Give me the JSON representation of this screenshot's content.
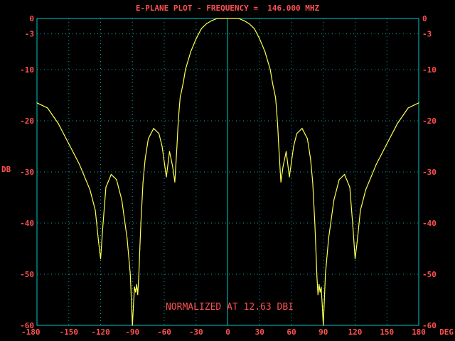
{
  "title": "E-PLANE PLOT - FREQUENCY =  146.000 MHZ",
  "annotation": "NORMALIZED AT 12.63 DBI",
  "colors": {
    "background": "#000000",
    "frame": "#00c8c8",
    "grid": "#00a8a8",
    "text": "#ff5050",
    "trace": "#ffff50"
  },
  "chart_data": {
    "type": "line",
    "title": "E-PLANE PLOT - FREQUENCY =  146.000 MHZ",
    "xlabel": "DEG",
    "ylabel": "DB",
    "xlim": [
      -180,
      180
    ],
    "ylim": [
      -60,
      0
    ],
    "grid": true,
    "legend": "none",
    "x_tick_labels": [
      "-180",
      "-150",
      "-120",
      "-90",
      "-60",
      "-30",
      "0",
      "30",
      "60",
      "90",
      "120",
      "150",
      "180"
    ],
    "y_tick_labels": [
      "0",
      "-3",
      "-10",
      "-20",
      "-30",
      "-40",
      "-50",
      "-60"
    ],
    "y_tick_values": [
      0,
      -3,
      -10,
      -20,
      -30,
      -40,
      -50,
      -60
    ],
    "annotations": [
      "NORMALIZED AT 12.63 DBI"
    ],
    "series": [
      {
        "x": [
          -180,
          -170,
          -160,
          -150,
          -140,
          -130,
          -125,
          -122,
          -120,
          -118,
          -115,
          -110,
          -105,
          -100,
          -95,
          -92,
          -90,
          -89,
          -88,
          -87,
          -86,
          -85,
          -84,
          -83,
          -82,
          -80,
          -78,
          -75,
          -70,
          -65,
          -62,
          -60,
          -58,
          -55,
          -52,
          -50,
          -48,
          -47,
          -46,
          -45,
          -42,
          -40,
          -35,
          -30,
          -25,
          -20,
          -15,
          -10,
          -5,
          0,
          5,
          10,
          15,
          20,
          25,
          30,
          35,
          40,
          42,
          45,
          46,
          47,
          48,
          50,
          52,
          55,
          58,
          60,
          62,
          65,
          70,
          75,
          78,
          80,
          82,
          83,
          84,
          85,
          86,
          87,
          88,
          89,
          90,
          92,
          95,
          100,
          105,
          110,
          115,
          118,
          120,
          122,
          125,
          130,
          140,
          150,
          160,
          170,
          180
        ],
        "y": [
          -16.5,
          -17.5,
          -20.5,
          -24.5,
          -28.5,
          -33.5,
          -37.5,
          -43.5,
          -47,
          -41,
          -33,
          -30.5,
          -31.5,
          -35.5,
          -43,
          -50,
          -60,
          -56,
          -52.5,
          -53.5,
          -52,
          -54,
          -50.5,
          -45,
          -40,
          -32,
          -27.5,
          -23.5,
          -21.5,
          -22.5,
          -25,
          -28,
          -31,
          -26,
          -29,
          -32,
          -25,
          -21,
          -18,
          -15.5,
          -12.5,
          -10,
          -6.5,
          -4,
          -2,
          -1,
          -0.4,
          0,
          0,
          0,
          0,
          0,
          -0.4,
          -1,
          -2,
          -4,
          -6.5,
          -10,
          -12.5,
          -15.5,
          -18,
          -21,
          -25,
          -32,
          -29,
          -26,
          -31,
          -28,
          -25,
          -22.5,
          -21.5,
          -23.5,
          -27.5,
          -32,
          -40,
          -45,
          -50.5,
          -54,
          -52,
          -53.5,
          -52.5,
          -56,
          -60,
          -50,
          -43,
          -35.5,
          -31.5,
          -30.5,
          -33,
          -41,
          -47,
          -43.5,
          -37.5,
          -33.5,
          -28.5,
          -24.5,
          -20.5,
          -17.5,
          -16.5
        ]
      }
    ]
  }
}
